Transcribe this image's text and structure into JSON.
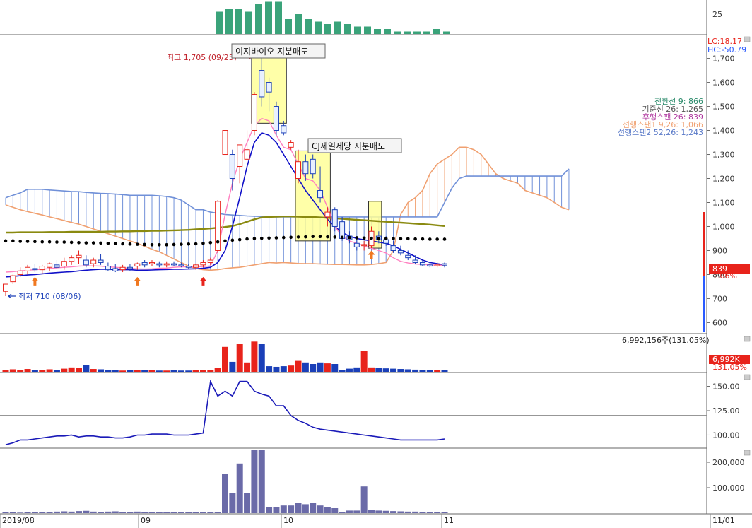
{
  "colors": {
    "up": "#e8231b",
    "down": "#1a3fb8",
    "conversion": "#ff80c0",
    "base": "#1010c8",
    "lagging": "#5a5a5a",
    "span1": "#f0a070",
    "span2": "#7090d8",
    "ma": "#8a8a10",
    "dots": "#000000",
    "mini_bar": "#3aa37a",
    "bottom_bar": "#6a6aa8",
    "highlight": "#ffff99",
    "price_badge": "#e8231b",
    "lc": "#e8231b",
    "hc": "#2a5aff"
  },
  "top_panel": {
    "tick": "25",
    "bars": [
      9,
      10,
      10,
      9,
      12,
      13,
      13,
      6,
      8,
      6,
      5,
      4,
      5,
      4,
      3,
      3,
      2,
      2,
      1,
      1,
      1,
      1,
      2,
      1
    ]
  },
  "main": {
    "y_ticks": [
      "1,700",
      "1,600",
      "1,500",
      "1,400",
      "1,300",
      "1,200",
      "1,100",
      "1,000",
      "900",
      "800",
      "700",
      "600"
    ],
    "y_values": [
      1700,
      1600,
      1500,
      1400,
      1300,
      1200,
      1100,
      1000,
      900,
      800,
      700,
      600
    ],
    "lc_label": "LC:18.17",
    "hc_label": "HC:-50.79",
    "price_badge": "839",
    "pct_badge": "1.06%",
    "legend": [
      {
        "text": "전환선 9: 866",
        "color": "#2a8a6a"
      },
      {
        "text": "기준선 26: 1,265",
        "color": "#555555"
      },
      {
        "text": "후행스팬 26: 839",
        "color": "#b03aa0"
      },
      {
        "text": "선행스팬1 9,26: 1,066",
        "color": "#f0a070"
      },
      {
        "text": "선행스팬2 52,26: 1,243",
        "color": "#5a7ac8"
      }
    ],
    "annotations": {
      "high": "최고 1,705 (09/25)",
      "low": "최저 710 (08/06)",
      "box1": "이지바이오 지분매도",
      "box2": "CJ제일제당 지분매도"
    }
  },
  "volume": {
    "header": "6,992,156주(131.05%)",
    "badge": "6,992K",
    "badge_pct": "131.05%"
  },
  "osc": {
    "y_ticks": [
      "150.00",
      "125.00",
      "100.00"
    ],
    "y_values": [
      150,
      125,
      100
    ],
    "ref": 120
  },
  "bottom": {
    "y_ticks": [
      "200,000",
      "100,000"
    ],
    "y_values": [
      200000,
      100000
    ]
  },
  "x_labels": [
    "2019/08",
    "09",
    "10",
    "11",
    "11/01"
  ],
  "chart_data": [
    {
      "type": "candlestick",
      "title": "",
      "ylim": [
        560,
        1790
      ],
      "dates": [
        "08/01",
        "08/02",
        "08/05",
        "08/06",
        "08/07",
        "08/08",
        "08/09",
        "08/12",
        "08/13",
        "08/14",
        "08/16",
        "08/19",
        "08/20",
        "08/21",
        "08/22",
        "08/23",
        "08/26",
        "08/27",
        "08/28",
        "08/29",
        "08/30",
        "09/02",
        "09/03",
        "09/04",
        "09/05",
        "09/06",
        "09/09",
        "09/10",
        "09/11",
        "09/16",
        "09/17",
        "09/18",
        "09/19",
        "09/20",
        "09/23",
        "09/24",
        "09/25",
        "09/26",
        "09/27",
        "09/30",
        "10/01",
        "10/02",
        "10/04",
        "10/07",
        "10/08",
        "10/10",
        "10/11",
        "10/14",
        "10/15",
        "10/16",
        "10/17",
        "10/18",
        "10/21",
        "10/22",
        "10/23",
        "10/24",
        "10/25",
        "10/28",
        "10/29",
        "10/30",
        "10/31"
      ],
      "candles": [
        {
          "o": 730,
          "h": 760,
          "l": 710,
          "c": 760
        },
        {
          "o": 770,
          "h": 800,
          "l": 760,
          "c": 795
        },
        {
          "o": 800,
          "h": 830,
          "l": 790,
          "c": 815
        },
        {
          "o": 815,
          "h": 840,
          "l": 800,
          "c": 830
        },
        {
          "o": 825,
          "h": 845,
          "l": 810,
          "c": 820
        },
        {
          "o": 820,
          "h": 840,
          "l": 805,
          "c": 835
        },
        {
          "o": 830,
          "h": 850,
          "l": 815,
          "c": 845
        },
        {
          "o": 840,
          "h": 860,
          "l": 825,
          "c": 830
        },
        {
          "o": 835,
          "h": 870,
          "l": 820,
          "c": 855
        },
        {
          "o": 855,
          "h": 880,
          "l": 840,
          "c": 870
        },
        {
          "o": 870,
          "h": 900,
          "l": 845,
          "c": 880
        },
        {
          "o": 860,
          "h": 880,
          "l": 830,
          "c": 840
        },
        {
          "o": 845,
          "h": 870,
          "l": 830,
          "c": 860
        },
        {
          "o": 860,
          "h": 885,
          "l": 840,
          "c": 850
        },
        {
          "o": 835,
          "h": 850,
          "l": 815,
          "c": 820
        },
        {
          "o": 825,
          "h": 845,
          "l": 810,
          "c": 815
        },
        {
          "o": 820,
          "h": 840,
          "l": 810,
          "c": 830
        },
        {
          "o": 830,
          "h": 845,
          "l": 815,
          "c": 825
        },
        {
          "o": 835,
          "h": 850,
          "l": 820,
          "c": 845
        },
        {
          "o": 850,
          "h": 860,
          "l": 830,
          "c": 840
        },
        {
          "o": 845,
          "h": 860,
          "l": 835,
          "c": 850
        },
        {
          "o": 845,
          "h": 855,
          "l": 830,
          "c": 840
        },
        {
          "o": 840,
          "h": 855,
          "l": 830,
          "c": 845
        },
        {
          "o": 845,
          "h": 855,
          "l": 835,
          "c": 840
        },
        {
          "o": 840,
          "h": 850,
          "l": 830,
          "c": 838
        },
        {
          "o": 835,
          "h": 845,
          "l": 825,
          "c": 830
        },
        {
          "o": 830,
          "h": 845,
          "l": 820,
          "c": 840
        },
        {
          "o": 840,
          "h": 860,
          "l": 830,
          "c": 850
        },
        {
          "o": 850,
          "h": 870,
          "l": 840,
          "c": 860
        },
        {
          "o": 900,
          "h": 1110,
          "l": 890,
          "c": 1105
        },
        {
          "o": 1300,
          "h": 1430,
          "l": 1290,
          "c": 1400
        },
        {
          "o": 1300,
          "h": 1320,
          "l": 1150,
          "c": 1200
        },
        {
          "o": 1250,
          "h": 1340,
          "l": 1180,
          "c": 1340
        },
        {
          "o": 1280,
          "h": 1400,
          "l": 1260,
          "c": 1320
        },
        {
          "o": 1400,
          "h": 1560,
          "l": 1380,
          "c": 1550
        },
        {
          "o": 1650,
          "h": 1705,
          "l": 1500,
          "c": 1540
        },
        {
          "o": 1600,
          "h": 1620,
          "l": 1480,
          "c": 1560
        },
        {
          "o": 1500,
          "h": 1520,
          "l": 1380,
          "c": 1400
        },
        {
          "o": 1420,
          "h": 1440,
          "l": 1380,
          "c": 1390
        },
        {
          "o": 1330,
          "h": 1360,
          "l": 1320,
          "c": 1350
        },
        {
          "o": 1200,
          "h": 1320,
          "l": 1180,
          "c": 1270
        },
        {
          "o": 1270,
          "h": 1300,
          "l": 1190,
          "c": 1220
        },
        {
          "o": 1280,
          "h": 1300,
          "l": 1200,
          "c": 1220
        },
        {
          "o": 1150,
          "h": 1250,
          "l": 1100,
          "c": 1120
        },
        {
          "o": 1040,
          "h": 1080,
          "l": 1000,
          "c": 1060
        },
        {
          "o": 1070,
          "h": 1080,
          "l": 980,
          "c": 1000
        },
        {
          "o": 1020,
          "h": 1040,
          "l": 940,
          "c": 950
        },
        {
          "o": 960,
          "h": 980,
          "l": 930,
          "c": 945
        },
        {
          "o": 930,
          "h": 950,
          "l": 900,
          "c": 915
        },
        {
          "o": 920,
          "h": 940,
          "l": 900,
          "c": 925
        },
        {
          "o": 920,
          "h": 1000,
          "l": 910,
          "c": 980
        },
        {
          "o": 960,
          "h": 980,
          "l": 930,
          "c": 945
        },
        {
          "o": 945,
          "h": 960,
          "l": 920,
          "c": 930
        },
        {
          "o": 920,
          "h": 940,
          "l": 890,
          "c": 900
        },
        {
          "o": 900,
          "h": 920,
          "l": 880,
          "c": 890
        },
        {
          "o": 880,
          "h": 900,
          "l": 860,
          "c": 870
        },
        {
          "o": 860,
          "h": 880,
          "l": 845,
          "c": 850
        },
        {
          "o": 850,
          "h": 860,
          "l": 835,
          "c": 840
        },
        {
          "o": 840,
          "h": 850,
          "l": 830,
          "c": 835
        },
        {
          "o": 838,
          "h": 850,
          "l": 830,
          "c": 840
        },
        {
          "o": 845,
          "h": 850,
          "l": 830,
          "c": 839
        }
      ],
      "volume_ratio": [
        0.05,
        0.08,
        0.06,
        0.09,
        0.05,
        0.06,
        0.08,
        0.06,
        0.1,
        0.14,
        0.12,
        0.22,
        0.09,
        0.08,
        0.06,
        0.05,
        0.04,
        0.05,
        0.06,
        0.05,
        0.05,
        0.04,
        0.04,
        0.05,
        0.04,
        0.04,
        0.05,
        0.06,
        0.06,
        0.12,
        0.8,
        0.32,
        0.9,
        0.3,
        0.97,
        0.9,
        0.18,
        0.16,
        0.18,
        0.2,
        0.35,
        0.3,
        0.25,
        0.3,
        0.27,
        0.25,
        0.05,
        0.1,
        0.14,
        0.68,
        0.14,
        0.12,
        0.11,
        0.1,
        0.09,
        0.08,
        0.07,
        0.06,
        0.06,
        0.06,
        0.06
      ],
      "conversion_line": [
        810,
        812,
        815,
        818,
        820,
        822,
        825,
        828,
        830,
        832,
        835,
        836,
        836,
        835,
        832,
        830,
        828,
        826,
        824,
        823,
        824,
        826,
        827,
        830,
        832,
        832,
        832,
        833,
        836,
        900,
        1050,
        1180,
        1280,
        1350,
        1420,
        1450,
        1440,
        1380,
        1330,
        1320,
        1260,
        1200,
        1190,
        1150,
        1080,
        1000,
        960,
        940,
        930,
        920,
        910,
        900,
        890,
        870,
        855,
        848,
        844,
        842,
        840,
        839,
        839
      ],
      "base_line": [
        790,
        792,
        795,
        798,
        800,
        803,
        806,
        808,
        810,
        812,
        815,
        818,
        820,
        822,
        822,
        820,
        820,
        820,
        818,
        818,
        819,
        820,
        821,
        822,
        822,
        823,
        824,
        826,
        830,
        850,
        900,
        1000,
        1120,
        1250,
        1350,
        1390,
        1380,
        1350,
        1300,
        1250,
        1200,
        1150,
        1110,
        1070,
        1030,
        1000,
        975,
        960,
        950,
        945,
        940,
        935,
        930,
        920,
        905,
        890,
        875,
        860,
        850,
        845,
        840
      ],
      "ichimoku_span1": [
        1090,
        1080,
        1070,
        1062,
        1055,
        1048,
        1040,
        1033,
        1025,
        1017,
        1010,
        1000,
        990,
        980,
        970,
        960,
        950,
        940,
        930,
        918,
        905,
        895,
        880,
        865,
        850,
        835,
        825,
        820,
        818,
        820,
        825,
        828,
        830,
        835,
        840,
        845,
        850,
        848,
        850,
        848,
        846,
        845,
        845,
        844,
        843,
        842,
        842,
        841,
        840,
        840,
        842,
        845,
        850,
        900,
        1050,
        1100,
        1120,
        1150,
        1220,
        1260,
        1280,
        1300,
        1330,
        1330,
        1320,
        1300,
        1260,
        1220,
        1200,
        1190,
        1180,
        1150,
        1140,
        1130,
        1120,
        1100,
        1080,
        1070
      ],
      "ichimoku_span2": [
        1120,
        1130,
        1140,
        1155,
        1155,
        1155,
        1152,
        1150,
        1148,
        1146,
        1145,
        1142,
        1140,
        1138,
        1137,
        1135,
        1133,
        1130,
        1130,
        1130,
        1130,
        1128,
        1125,
        1120,
        1110,
        1090,
        1070,
        1070,
        1060,
        1055,
        1050,
        1048,
        1046,
        1044,
        1043,
        1042,
        1041,
        1040,
        1040,
        1040,
        1040,
        1040,
        1040,
        1040,
        1040,
        1040,
        1040,
        1040,
        1040,
        1040,
        1040,
        1040,
        1040,
        1040,
        1040,
        1040,
        1040,
        1040,
        1040,
        1040,
        1100,
        1160,
        1200,
        1210,
        1210,
        1210,
        1210,
        1210,
        1210,
        1210,
        1210,
        1210,
        1210,
        1210,
        1210,
        1210,
        1210,
        1240,
        1240,
        1240,
        1240
      ],
      "moving_average": [
        975,
        975,
        976,
        976,
        976,
        976,
        977,
        977,
        977,
        978,
        978,
        978,
        978,
        978,
        979,
        979,
        980,
        980,
        981,
        981,
        982,
        982,
        983,
        984,
        985,
        986,
        988,
        990,
        992,
        995,
        998,
        1002,
        1010,
        1020,
        1030,
        1038,
        1040,
        1041,
        1042,
        1042,
        1041,
        1040,
        1040,
        1038,
        1036,
        1034,
        1032,
        1030,
        1028,
        1026,
        1024,
        1022,
        1020,
        1018,
        1016,
        1014,
        1012,
        1010,
        1008,
        1005,
        1002
      ],
      "lagging_dots": [
        940,
        940,
        938,
        938,
        937,
        936,
        936,
        935,
        935,
        934,
        933,
        932,
        932,
        931,
        930,
        929,
        928,
        927,
        926,
        925,
        924,
        924,
        924,
        925,
        926,
        927,
        928,
        930,
        933,
        936,
        940,
        943,
        945,
        948,
        950,
        951,
        952,
        953,
        954,
        955,
        956,
        957,
        958,
        958,
        957,
        956,
        955,
        954,
        953,
        952,
        951,
        950,
        950,
        950,
        949,
        949,
        948,
        948,
        947,
        947,
        947
      ]
    },
    {
      "type": "line",
      "title": "",
      "ylim": [
        88,
        162
      ],
      "values": [
        90,
        92,
        95,
        95,
        96,
        97,
        98,
        99,
        99,
        100,
        98,
        99,
        99,
        98,
        98,
        97,
        97,
        98,
        100,
        100,
        101,
        101,
        101,
        100,
        100,
        100,
        101,
        102,
        155,
        140,
        145,
        140,
        155,
        155,
        145,
        142,
        140,
        130,
        130,
        120,
        115,
        112,
        108,
        106,
        105,
        104,
        103,
        102,
        101,
        100,
        99,
        98,
        97,
        96,
        95,
        95,
        95,
        95,
        95,
        95,
        96
      ]
    },
    {
      "type": "bar",
      "title": "",
      "ylim": [
        0,
        250000
      ],
      "values": [
        3000,
        3500,
        2000,
        4000,
        3000,
        5000,
        4000,
        6000,
        7000,
        6000,
        8000,
        9000,
        6000,
        5000,
        6000,
        7000,
        4000,
        5000,
        6000,
        5000,
        4000,
        5000,
        4000,
        4000,
        3500,
        3500,
        4000,
        4500,
        5000,
        5000,
        155000,
        80000,
        195000,
        80000,
        250000,
        275000,
        25000,
        25000,
        30000,
        30000,
        40000,
        35000,
        40000,
        30000,
        25000,
        20000,
        5000,
        10000,
        10000,
        105000,
        12000,
        10000,
        9000,
        8000,
        7000,
        6000,
        6000,
        5000,
        5000,
        5000,
        5000
      ]
    }
  ]
}
